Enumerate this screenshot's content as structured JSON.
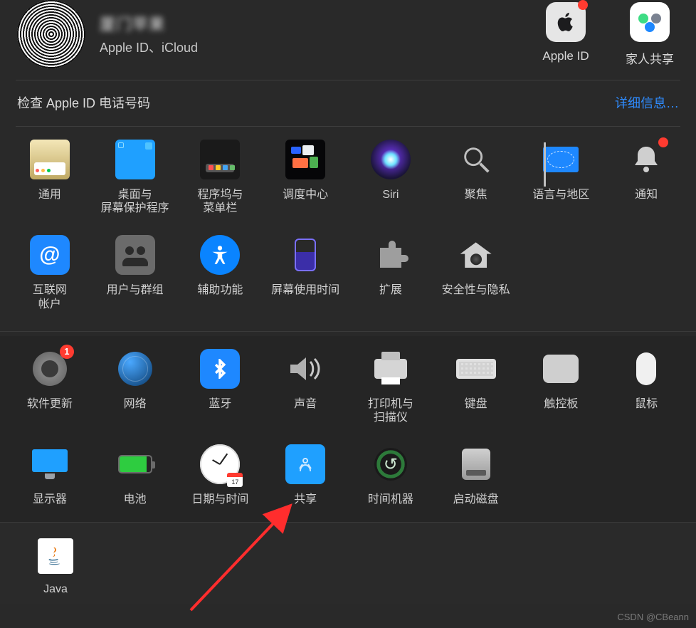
{
  "header": {
    "user_name": "厦门苹果",
    "user_sub": "Apple ID、iCloud",
    "apple_id": {
      "label": "Apple ID",
      "badge": true
    },
    "family": {
      "label": "家人共享"
    }
  },
  "notice": {
    "text": "检查 Apple ID 电话号码",
    "link": "详细信息…"
  },
  "row1": [
    {
      "key": "general",
      "label": "通用"
    },
    {
      "key": "desktop",
      "label": "桌面与\n屏幕保护程序"
    },
    {
      "key": "dock",
      "label": "程序坞与\n菜单栏"
    },
    {
      "key": "mission",
      "label": "调度中心"
    },
    {
      "key": "siri",
      "label": "Siri"
    },
    {
      "key": "spotlight",
      "label": "聚焦"
    },
    {
      "key": "language",
      "label": "语言与地区"
    },
    {
      "key": "notif",
      "label": "通知",
      "badge": true
    }
  ],
  "row2": [
    {
      "key": "internet",
      "label": "互联网\n帐户"
    },
    {
      "key": "users",
      "label": "用户与群组"
    },
    {
      "key": "access",
      "label": "辅助功能"
    },
    {
      "key": "screentime",
      "label": "屏幕使用时间"
    },
    {
      "key": "ext",
      "label": "扩展"
    },
    {
      "key": "security",
      "label": "安全性与隐私"
    }
  ],
  "row3": [
    {
      "key": "update",
      "label": "软件更新",
      "badge_num": "1"
    },
    {
      "key": "network",
      "label": "网络"
    },
    {
      "key": "bt",
      "label": "蓝牙"
    },
    {
      "key": "sound",
      "label": "声音"
    },
    {
      "key": "printer",
      "label": "打印机与\n扫描仪"
    },
    {
      "key": "keyboard",
      "label": "键盘"
    },
    {
      "key": "trackpad",
      "label": "触控板"
    },
    {
      "key": "mouse",
      "label": "鼠标"
    }
  ],
  "row4": [
    {
      "key": "display",
      "label": "显示器"
    },
    {
      "key": "battery",
      "label": "电池"
    },
    {
      "key": "datetime",
      "label": "日期与时间",
      "cal": "17"
    },
    {
      "key": "share",
      "label": "共享"
    },
    {
      "key": "time",
      "label": "时间机器"
    },
    {
      "key": "boot",
      "label": "启动磁盘"
    }
  ],
  "java": {
    "label": "Java"
  },
  "watermark": "CSDN @CBeann"
}
